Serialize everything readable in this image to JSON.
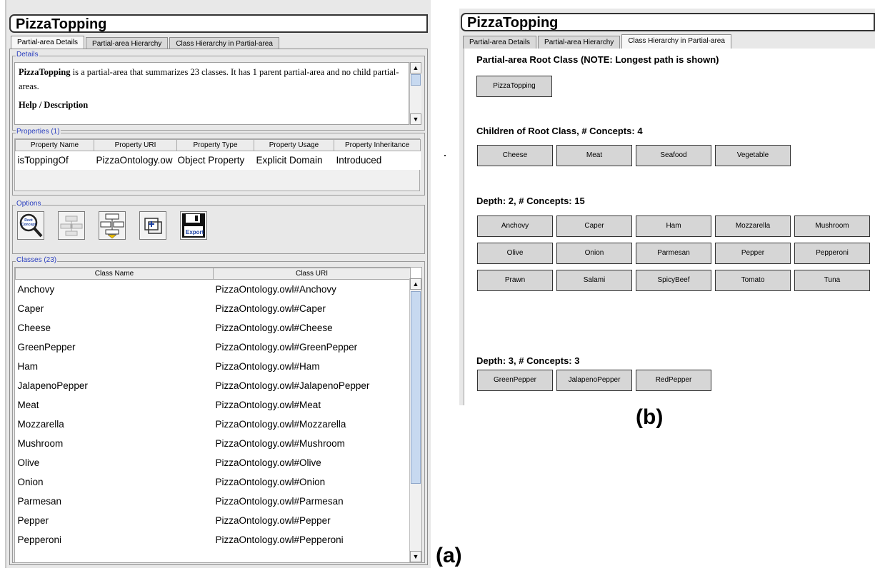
{
  "left_panel": {
    "title": "PizzaTopping",
    "tabs": [
      "Partial-area Details",
      "Partial-area Hierarchy",
      "Class Hierarchy in Partial-area"
    ],
    "details": {
      "legend": "Details",
      "name": "PizzaTopping",
      "text": " is a partial-area that summarizes 23 classes. It has 1 parent partial-area and no child partial-areas.",
      "help_heading": "Help / Description"
    },
    "properties": {
      "legend": "Properties (1)",
      "columns": [
        "Property Name",
        "Property URI",
        "Property Type",
        "Property Usage",
        "Property Inheritance"
      ],
      "rows": [
        [
          "isToppingOf",
          "PizzaOntology.ow",
          "Object Property",
          "Explicit Domain",
          "Introduced"
        ]
      ]
    },
    "options": {
      "legend": "Options",
      "buttons": [
        "root-concept-icon",
        "hierarchy-icon",
        "expand-hierarchy-icon",
        "add-window-icon",
        "export-icon"
      ],
      "root_concept_text": "Root Concept",
      "export_text": "Export"
    },
    "classes": {
      "legend": "Classes (23)",
      "columns": [
        "Class Name",
        "Class URI"
      ],
      "rows": [
        [
          "Anchovy",
          "PizzaOntology.owl#Anchovy"
        ],
        [
          "Caper",
          "PizzaOntology.owl#Caper"
        ],
        [
          "Cheese",
          "PizzaOntology.owl#Cheese"
        ],
        [
          "GreenPepper",
          "PizzaOntology.owl#GreenPepper"
        ],
        [
          "Ham",
          "PizzaOntology.owl#Ham"
        ],
        [
          "JalapenoPepper",
          "PizzaOntology.owl#JalapenoPepper"
        ],
        [
          "Meat",
          "PizzaOntology.owl#Meat"
        ],
        [
          "Mozzarella",
          "PizzaOntology.owl#Mozzarella"
        ],
        [
          "Mushroom",
          "PizzaOntology.owl#Mushroom"
        ],
        [
          "Olive",
          "PizzaOntology.owl#Olive"
        ],
        [
          "Onion",
          "PizzaOntology.owl#Onion"
        ],
        [
          "Parmesan",
          "PizzaOntology.owl#Parmesan"
        ],
        [
          "Pepper",
          "PizzaOntology.owl#Pepper"
        ],
        [
          "Pepperoni",
          "PizzaOntology.owl#Pepperoni"
        ]
      ]
    },
    "caption": "(a)"
  },
  "right_panel": {
    "title": "PizzaTopping",
    "tabs": [
      "Partial-area Details",
      "Partial-area Hierarchy",
      "Class Hierarchy in Partial-area"
    ],
    "root_heading": "Partial-area Root Class (NOTE: Longest path is shown)",
    "root_class": "PizzaTopping",
    "children_heading": "Children of Root Class, # Concepts: 4",
    "children": [
      "Cheese",
      "Meat",
      "Seafood",
      "Vegetable"
    ],
    "depth2_heading": "Depth: 2, # Concepts: 15",
    "depth2": [
      "Anchovy",
      "Caper",
      "Ham",
      "Mozzarella",
      "Mushroom",
      "Olive",
      "Onion",
      "Parmesan",
      "Pepper",
      "Pepperoni",
      "Prawn",
      "Salami",
      "SpicyBeef",
      "Tomato",
      "Tuna"
    ],
    "depth3_heading": "Depth: 3, # Concepts: 3",
    "depth3": [
      "GreenPepper",
      "JalapenoPepper",
      "RedPepper"
    ],
    "caption": "(b)"
  },
  "colors": {
    "panel_bg": "#e8e8e8",
    "legend_blue": "#2a3fbf",
    "box_fill": "#d6d6d6",
    "scroll_thumb": "#c7d9f0"
  }
}
